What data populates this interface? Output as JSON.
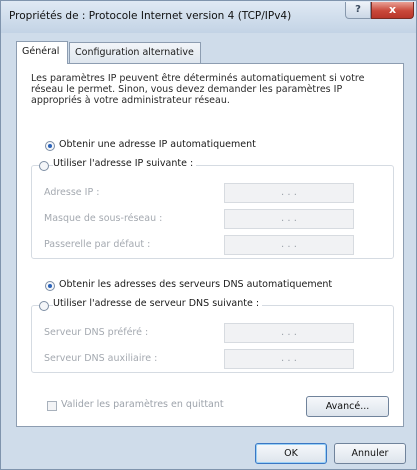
{
  "window": {
    "title": "Propriétés de : Protocole Internet version 4 (TCP/IPv4)",
    "help_label": "?",
    "close_label": "x"
  },
  "tabs": [
    {
      "label": "Général",
      "selected": true
    },
    {
      "label": "Configuration alternative",
      "selected": false
    }
  ],
  "intro_text": "Les paramètres IP peuvent être déterminés automatiquement si votre réseau le permet. Sinon, vous devez demander les paramètres IP appropriés à votre administrateur réseau.",
  "ip_section": {
    "auto_label": "Obtenir une adresse IP automatiquement",
    "auto_selected": true,
    "manual_label": "Utiliser l'adresse IP suivante :",
    "fields": [
      {
        "label": "Adresse IP :",
        "value": ". . ."
      },
      {
        "label": "Masque de sous-réseau :",
        "value": ". . ."
      },
      {
        "label": "Passerelle par défaut :",
        "value": ". . ."
      }
    ]
  },
  "dns_section": {
    "auto_label": "Obtenir les adresses des serveurs DNS automatiquement",
    "auto_selected": true,
    "manual_label": "Utiliser l'adresse de serveur DNS suivante :",
    "fields": [
      {
        "label": "Serveur DNS préféré :",
        "value": ". . ."
      },
      {
        "label": "Serveur DNS auxiliaire :",
        "value": ". . ."
      }
    ]
  },
  "validate_checkbox": {
    "label": "Valider les paramètres en quittant",
    "checked": false
  },
  "buttons": {
    "advanced": "Avancé...",
    "ok": "OK",
    "cancel": "Annuler"
  }
}
